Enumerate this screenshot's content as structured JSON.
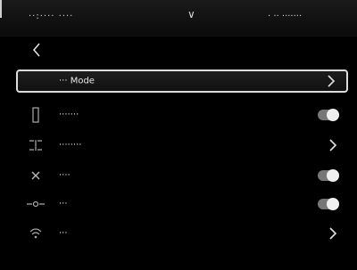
{
  "status_bar": {
    "left_text": "··:····  ····",
    "chevron": "∨",
    "right_text": "· ·· ·······"
  },
  "back_button": {
    "icon": "chevron-left-icon"
  },
  "menu": {
    "items": [
      {
        "label": "··· Mode",
        "icon": "",
        "control": "chevron",
        "selected": true
      },
      {
        "label": "·······",
        "icon": "flashlight-icon",
        "control": "toggle",
        "on": true
      },
      {
        "label": "········",
        "icon": "display-icon",
        "control": "chevron"
      },
      {
        "label": "····",
        "icon": "close-icon",
        "control": "toggle",
        "on": true
      },
      {
        "label": "···",
        "icon": "laser-icon",
        "control": "toggle",
        "on": true
      },
      {
        "label": "···",
        "icon": "wifi-icon",
        "control": "chevron"
      }
    ]
  },
  "colors": {
    "background": "#000000",
    "text": "#f2f2f2",
    "toggle_track": "#777777",
    "toggle_knob": "#f0f0f0"
  }
}
